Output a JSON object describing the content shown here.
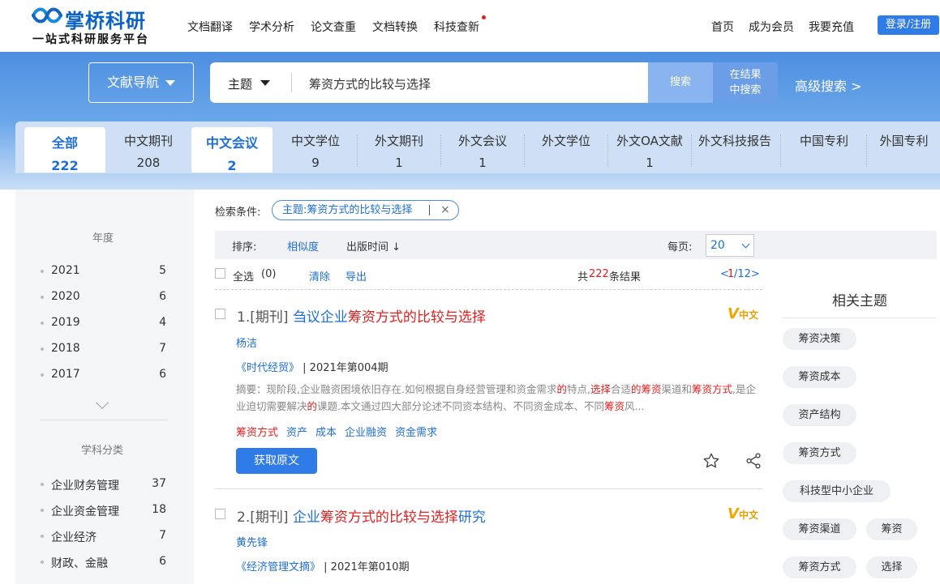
{
  "brand": {
    "name": "掌桥科研",
    "slogan": "一站式科研服务平台"
  },
  "top_nav": [
    "文档翻译",
    "学术分析",
    "论文查重",
    "文档转换",
    "科技查新"
  ],
  "top_right": [
    "首页",
    "成为会员",
    "我要充值"
  ],
  "login_label": "登录/注册",
  "search": {
    "nav_label": "文献导航",
    "field": "主题",
    "query": "筹资方式的比较与选择",
    "search_label": "搜索",
    "in_result_line1": "在结果",
    "in_result_line2": "中搜索",
    "advanced": "高级搜索 >"
  },
  "tabs": [
    {
      "name": "全部",
      "count": "222"
    },
    {
      "name": "中文期刊",
      "count": "208"
    },
    {
      "name": "中文会议",
      "count": "2"
    },
    {
      "name": "中文学位",
      "count": "9"
    },
    {
      "name": "外文期刊",
      "count": "1"
    },
    {
      "name": "外文会议",
      "count": "1"
    },
    {
      "name": "外文学位",
      "count": ""
    },
    {
      "name": "外文OA文献",
      "count": "1"
    },
    {
      "name": "外文科技报告",
      "count": ""
    },
    {
      "name": "中国专利",
      "count": ""
    },
    {
      "name": "外国专利",
      "count": ""
    }
  ],
  "sidebar": {
    "year_heading": "年度",
    "years": [
      {
        "label": "2021",
        "count": "5"
      },
      {
        "label": "2020",
        "count": "6"
      },
      {
        "label": "2019",
        "count": "4"
      },
      {
        "label": "2018",
        "count": "7"
      },
      {
        "label": "2017",
        "count": "6"
      }
    ],
    "subject_heading": "学科分类",
    "subjects": [
      {
        "label": "企业财务管理",
        "count": "37"
      },
      {
        "label": "企业资金管理",
        "count": "18"
      },
      {
        "label": "企业经济",
        "count": "7"
      },
      {
        "label": "财政、金融",
        "count": "6"
      }
    ]
  },
  "conditions": {
    "label": "检索条件:",
    "chip": "主题:筹资方式的比较与选择"
  },
  "sort": {
    "label": "排序:",
    "relevance": "相似度",
    "date": "出版时间 ↓",
    "per_page_label": "每页:",
    "per_page": "20"
  },
  "toolbar": {
    "select_all": "全选",
    "selected": "(0)",
    "clear": "清除",
    "export": "导出",
    "total_prefix": "共",
    "total": "222",
    "total_suffix": "条结果",
    "page_prefix": "<",
    "page_current": "1",
    "page_rest": "/12>"
  },
  "results": [
    {
      "num": "1.[期刊]",
      "title_blue": "刍议企业",
      "title_red": "筹资方式的比较与选择",
      "title_tail": "",
      "author": "杨洁",
      "source": "《时代经贸》",
      "issue": "| 2021年第004期",
      "abstract_a": "摘要：现阶段,企业融资困境依旧存在.如何根据自身经营管理和资金需求",
      "abstract_b": "的",
      "abstract_c": "特点,",
      "abstract_d": "选择",
      "abstract_e": "合适",
      "abstract_f": "的筹资",
      "abstract_g": "渠道和",
      "abstract_h": "筹资方式",
      "abstract_i": ",是企业迫切需要解决",
      "abstract_j": "的",
      "abstract_k": "课题.本文通过四大部分论述不同资本结构、不同资金成本、不同",
      "abstract_l": "筹资",
      "abstract_m": "风...",
      "keywords": [
        "筹资方式",
        "资产",
        "成本",
        "企业融资",
        "资金需求"
      ],
      "get": "获取原文",
      "lang": "中文"
    },
    {
      "num": "2.[期刊]",
      "title_blue": "企业",
      "title_red": "筹资方式的比较与选择",
      "title_tail": "研究",
      "author": "黄先锋",
      "source": "《经济管理文摘》",
      "issue": "| 2021年第010期",
      "lang": "中文"
    }
  ],
  "related": {
    "heading": "相关主题",
    "tags": [
      "筹资决策",
      "筹资成本",
      "资产结构",
      "筹资方式",
      "科技型中小企业",
      "筹资渠道",
      "筹资",
      "筹资方式",
      "选择"
    ]
  },
  "colors": {
    "accent": "#2f7be8",
    "highlight": "#e02020",
    "link": "#1f6fd8"
  }
}
